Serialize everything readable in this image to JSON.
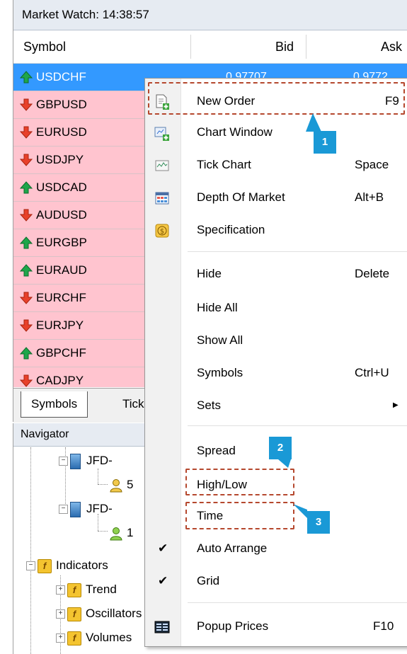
{
  "market_watch": {
    "title": "Market Watch: 14:38:57",
    "columns": {
      "symbol": "Symbol",
      "bid": "Bid",
      "ask": "Ask"
    },
    "rows": [
      {
        "symbol": "USDCHF",
        "direction": "up",
        "selected": true,
        "bid": "0.97707",
        "ask": "0.9772"
      },
      {
        "symbol": "GBPUSD",
        "direction": "down"
      },
      {
        "symbol": "EURUSD",
        "direction": "down"
      },
      {
        "symbol": "USDJPY",
        "direction": "down"
      },
      {
        "symbol": "USDCAD",
        "direction": "up"
      },
      {
        "symbol": "AUDUSD",
        "direction": "down"
      },
      {
        "symbol": "EURGBP",
        "direction": "up"
      },
      {
        "symbol": "EURAUD",
        "direction": "up"
      },
      {
        "symbol": "EURCHF",
        "direction": "down"
      },
      {
        "symbol": "EURJPY",
        "direction": "down"
      },
      {
        "symbol": "GBPCHF",
        "direction": "up"
      },
      {
        "symbol": "CADJPY",
        "direction": "down"
      }
    ],
    "tabs": [
      "Symbols",
      "Tick"
    ]
  },
  "navigator": {
    "title": "Navigator",
    "nodes": [
      {
        "label": "JFD-",
        "kind": "server"
      },
      {
        "label": "5",
        "kind": "account"
      },
      {
        "label": "JFD-",
        "kind": "server"
      },
      {
        "label": "1",
        "kind": "account"
      },
      {
        "label": "Indicators",
        "kind": "folder"
      },
      {
        "label": "Trend",
        "kind": "folder"
      },
      {
        "label": "Oscillators",
        "kind": "folder"
      },
      {
        "label": "Volumes",
        "kind": "folder"
      }
    ]
  },
  "context_menu": {
    "items": [
      {
        "label": "New Order",
        "shortcut": "F9",
        "icon": "new-order-icon"
      },
      {
        "label": "Chart Window",
        "shortcut": "",
        "icon": "chart-window-icon"
      },
      {
        "label": "Tick Chart",
        "shortcut": "Space",
        "icon": "tick-chart-icon"
      },
      {
        "label": "Depth Of Market",
        "shortcut": "Alt+B",
        "icon": "depth-of-market-icon"
      },
      {
        "label": "Specification",
        "shortcut": "",
        "icon": "specification-icon"
      },
      {
        "label": "Hide",
        "shortcut": "Delete"
      },
      {
        "label": "Hide All",
        "shortcut": ""
      },
      {
        "label": "Show All",
        "shortcut": ""
      },
      {
        "label": "Symbols",
        "shortcut": "Ctrl+U"
      },
      {
        "label": "Sets",
        "shortcut": "",
        "submenu": true
      },
      {
        "label": "Spread",
        "shortcut": ""
      },
      {
        "label": "High/Low",
        "shortcut": ""
      },
      {
        "label": "Time",
        "shortcut": ""
      },
      {
        "label": "Auto Arrange",
        "shortcut": "",
        "checked": true
      },
      {
        "label": "Grid",
        "shortcut": "",
        "checked": true
      },
      {
        "label": "Popup Prices",
        "shortcut": "F10",
        "icon": "popup-prices-icon"
      }
    ]
  },
  "annotations": {
    "badge1": "1",
    "badge2": "2",
    "badge3": "3"
  },
  "colors": {
    "up": "#1fa64a",
    "down": "#e8402a",
    "row_bg": "#ffc4cf",
    "selected_bg": "#3399ff",
    "highlight": "#b5482e",
    "badge": "#1a99d6"
  }
}
